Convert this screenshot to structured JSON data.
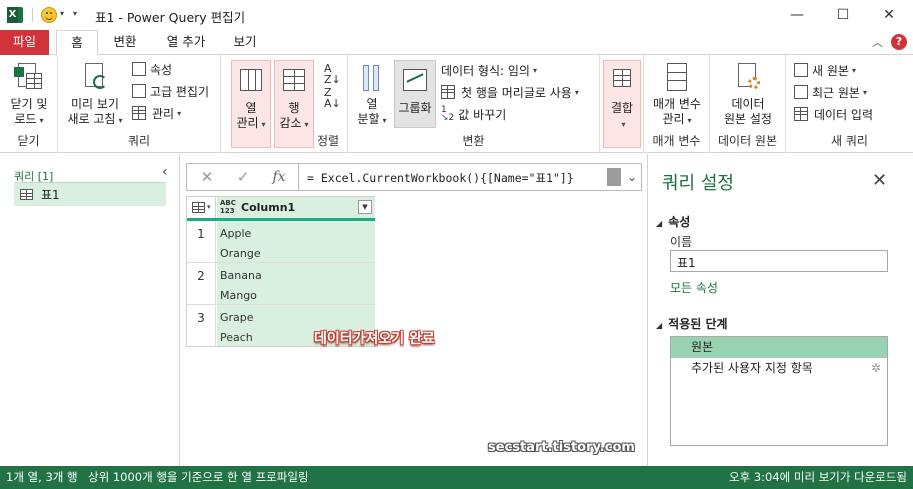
{
  "titlebar": {
    "title": "표1 - Power Query 편집기",
    "minimize": "—",
    "maximize": "☐",
    "close": "✕"
  },
  "tabs": {
    "file": "파일",
    "home": "홈",
    "transform": "변환",
    "add_column": "열 추가",
    "view": "보기"
  },
  "ribbon": {
    "close": {
      "button": "닫기 및\n로드",
      "label_line1": "닫기 및",
      "label_line2": "로드",
      "group": "닫기"
    },
    "query": {
      "refresh_line1": "미리 보기",
      "refresh_line2": "새로 고침",
      "properties": "속성",
      "advanced_editor": "고급 편집기",
      "manage": "관리",
      "group": "쿼리"
    },
    "manage_columns": {
      "line1": "열",
      "line2": "관리"
    },
    "reduce_rows": {
      "line1": "행",
      "line2": "감소"
    },
    "sort": {
      "group": "정렬"
    },
    "split_column": {
      "line1": "열",
      "line2": "분할"
    },
    "group_by": "그룹화",
    "transform": {
      "data_type": "데이터 형식: 임의",
      "first_row_header": "첫 행을 머리글로 사용",
      "replace_values": "값 바꾸기",
      "group": "변환"
    },
    "combine": {
      "label": "결합"
    },
    "parameters": {
      "line1": "매개 변수",
      "line2": "관리",
      "group": "매개 변수"
    },
    "data_source": {
      "line1": "데이터",
      "line2": "원본 설정",
      "group": "데이터 원본"
    },
    "new_query": {
      "new_source": "새 원본",
      "recent_sources": "최근 원본",
      "enter_data": "데이터 입력",
      "group": "새 쿼리"
    }
  },
  "queries_pane": {
    "title": "쿼리 [1]",
    "items": [
      {
        "label": "표1"
      }
    ]
  },
  "formula_bar": {
    "cancel": "✕",
    "accept": "✓",
    "fx": "fx",
    "formula": "= Excel.CurrentWorkbook(){[Name=\"표1\"]}"
  },
  "grid": {
    "type_badge_top": "ABC",
    "type_badge_bottom": "123",
    "column": "Column1",
    "rows": [
      {
        "n": "1",
        "a": "Apple",
        "b": "Orange"
      },
      {
        "n": "2",
        "a": "Banana",
        "b": "Mango"
      },
      {
        "n": "3",
        "a": "Grape",
        "b": "Peach"
      }
    ]
  },
  "overlay": "데이터가져오기 완료",
  "watermark": "secstart.tistory.com",
  "settings": {
    "title": "쿼리 설정",
    "properties_section": "속성",
    "name_label": "이름",
    "name_value": "표1",
    "all_properties": "모든 속성",
    "applied_steps_section": "적용된 단계",
    "steps": [
      {
        "label": "원본"
      },
      {
        "label": "추가된 사용자 지정 항목"
      }
    ]
  },
  "status": {
    "left": "1개 열, 3개 행",
    "middle": "상위 1000개 행을 기준으로 한 열 프로파일링",
    "right": "오후 3:04에 미리 보기가 다운로드됨"
  },
  "colors": {
    "excel_green": "#217346",
    "file_tab_red": "#d13438",
    "selection_green": "#d9efe0",
    "step_selected": "#98d2b0"
  }
}
